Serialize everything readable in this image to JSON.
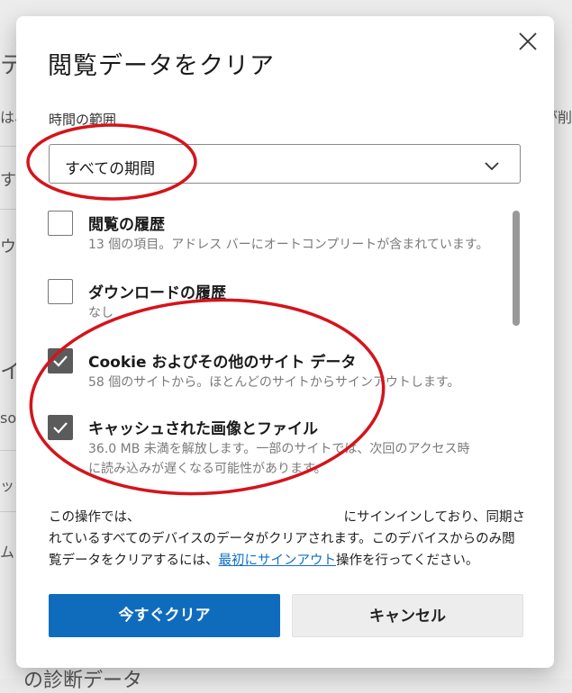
{
  "background": {
    "fragments": [
      "テ",
      "は、",
      "すぐ",
      "ウ",
      "イル",
      "so",
      "ッキ",
      "ムい"
    ],
    "right_fragments": [
      "が削"
    ],
    "bottom_text": "の診断データ"
  },
  "dialog": {
    "title": "閲覧データをクリア",
    "close_icon": "close-icon",
    "time_range": {
      "label": "時間の範囲",
      "selected": "すべての期間"
    },
    "items": [
      {
        "title": "閲覧の履歴",
        "desc": "13 個の項目。アドレス バーにオートコンプリートが含まれています。",
        "checked": false
      },
      {
        "title": "ダウンロードの履歴",
        "desc": "なし",
        "checked": false
      },
      {
        "title": "Cookie およびその他のサイト データ",
        "desc": "58 個のサイトから。ほとんどのサイトからサインアウトします。",
        "checked": true
      },
      {
        "title": "キャッシュされた画像とファイル",
        "desc_line1": "36.0 MB 未満を解放します。一部のサイトでは、次回のアクセス時",
        "desc_line2": "に読み込みが遅くなる可能性があります。",
        "checked": true
      }
    ],
    "note": {
      "part1": "この操作では、",
      "part2": "にサインインしており、同期されているすべてのデバイスのデータがクリアされます。このデバイスからのみ閲覧データをクリアするには、",
      "link": "最初にサインアウト",
      "part3": "操作を行ってください。"
    },
    "buttons": {
      "clear": "今すぐクリア",
      "cancel": "キャンセル"
    }
  },
  "colors": {
    "primary": "#0f6cbd",
    "link": "#0e6fc5",
    "checkbox_checked": "#5b5b5b",
    "annotation_red": "#d4141c"
  }
}
